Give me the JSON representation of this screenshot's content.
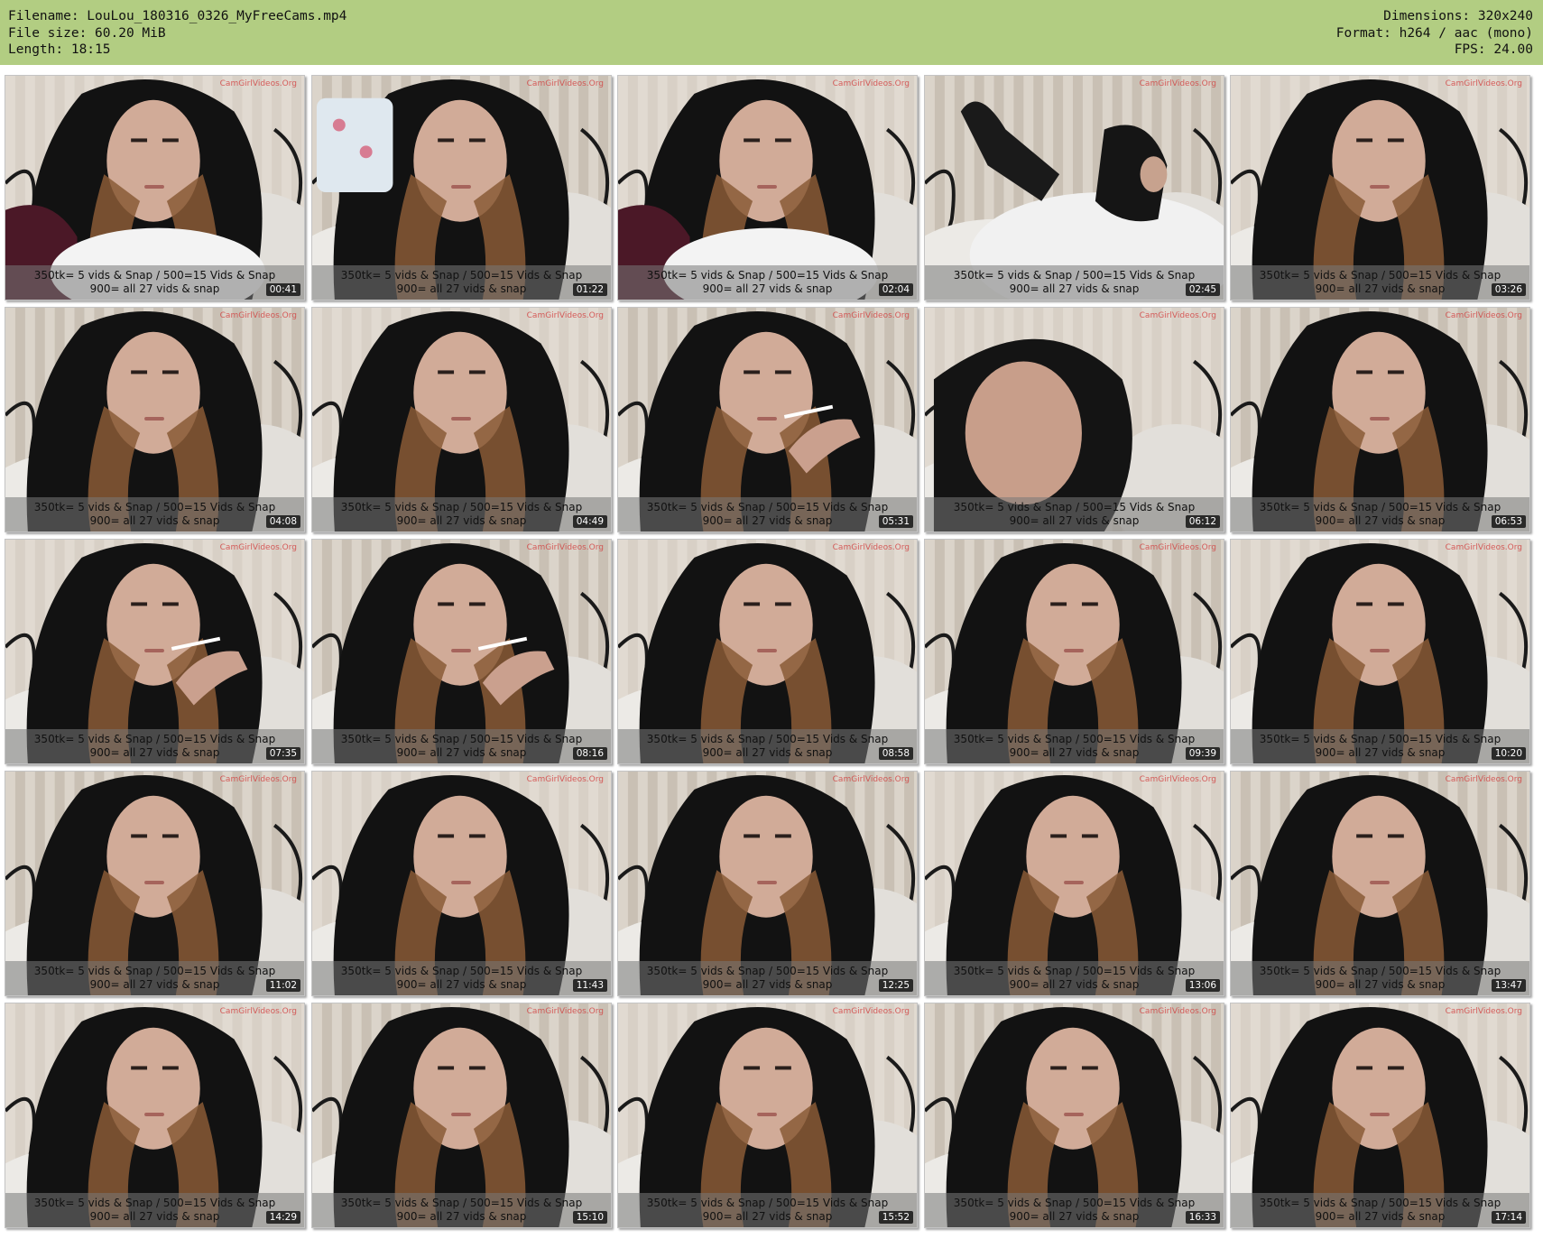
{
  "header": {
    "filename": "Filename: LouLou_180316_0326_MyFreeCams.mp4",
    "filesize": "File size: 60.20 MiB",
    "length": "Length: 18:15",
    "dimensions": "Dimensions: 320x240",
    "format": "Format: h264 / aac (mono)",
    "fps": "FPS: 24.00"
  },
  "caption": {
    "line1": "350tk= 5 vids & Snap / 500=15 Vids & Snap",
    "line2": "900= all 27 vids & snap",
    "watermark": "CamGirlVideos.Org"
  },
  "thumbnails": [
    {
      "time": "00:41",
      "scene": "hood-bed"
    },
    {
      "time": "01:22",
      "scene": "mug"
    },
    {
      "time": "02:04",
      "scene": "hood-bed"
    },
    {
      "time": "02:45",
      "scene": "reclining"
    },
    {
      "time": "03:26",
      "scene": "face"
    },
    {
      "time": "04:08",
      "scene": "face"
    },
    {
      "time": "04:49",
      "scene": "face"
    },
    {
      "time": "05:31",
      "scene": "smoking"
    },
    {
      "time": "06:12",
      "scene": "hood-upward"
    },
    {
      "time": "06:53",
      "scene": "face"
    },
    {
      "time": "07:35",
      "scene": "smoking"
    },
    {
      "time": "08:16",
      "scene": "smoking"
    },
    {
      "time": "08:58",
      "scene": "face"
    },
    {
      "time": "09:39",
      "scene": "face"
    },
    {
      "time": "10:20",
      "scene": "face"
    },
    {
      "time": "11:02",
      "scene": "face"
    },
    {
      "time": "11:43",
      "scene": "face"
    },
    {
      "time": "12:25",
      "scene": "face"
    },
    {
      "time": "13:06",
      "scene": "face"
    },
    {
      "time": "13:47",
      "scene": "face"
    },
    {
      "time": "14:29",
      "scene": "face"
    },
    {
      "time": "15:10",
      "scene": "face"
    },
    {
      "time": "15:52",
      "scene": "face"
    },
    {
      "time": "16:33",
      "scene": "face"
    },
    {
      "time": "17:14",
      "scene": "face"
    }
  ]
}
